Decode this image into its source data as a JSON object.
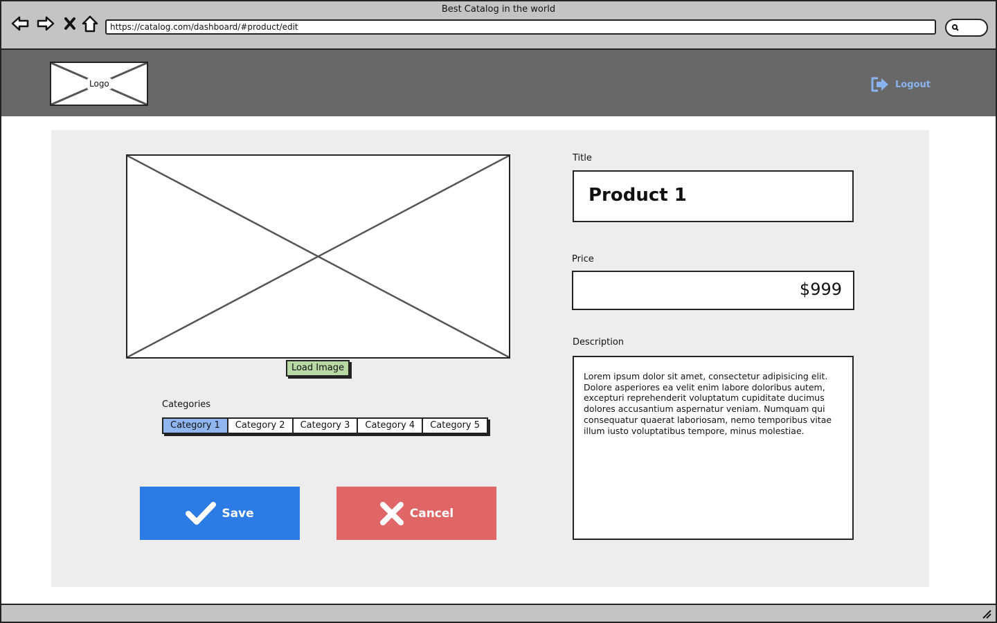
{
  "browser": {
    "window_title": "Best Catalog in the world",
    "url": "https://catalog.com/dashboard/#product/edit",
    "icons": [
      "back-arrow-icon",
      "forward-arrow-icon",
      "close-icon",
      "home-icon",
      "search-icon"
    ]
  },
  "header": {
    "logo_label": "Logo",
    "logout_label": "Logout",
    "logout_icon": "logout-icon"
  },
  "product": {
    "load_image_label": "Load Image",
    "categories_label": "Categories",
    "categories": [
      "Category 1",
      "Category 2",
      "Category 3",
      "Category 4",
      "Category 5"
    ],
    "active_category": "Category 1",
    "save_label": "Save",
    "cancel_label": "Cancel"
  },
  "form": {
    "title_label": "Title",
    "title_value": "Product 1",
    "price_label": "Price",
    "price_value": "$999",
    "description_label": "Description",
    "description_value": "Lorem ipsum dolor sit amet, consectetur adipisicing elit. Dolore asperiores ea velit enim labore doloribus autem, excepturi reprehenderit voluptatum cupiditate ducimus dolores accusantium aspernatur veniam. Numquam qui consequatur quaerat laboriosam, nemo temporibus vitae illum iusto voluptatibus tempore, minus molestiae."
  },
  "colors": {
    "header_bg": "#686868",
    "panel_bg": "#ededed",
    "save_bg": "#2d7be5",
    "cancel_bg": "#e06666",
    "active_tab_bg": "#8fb6ef",
    "load_image_bg": "#b8d8a4",
    "logout_color": "#8ab4f0"
  }
}
